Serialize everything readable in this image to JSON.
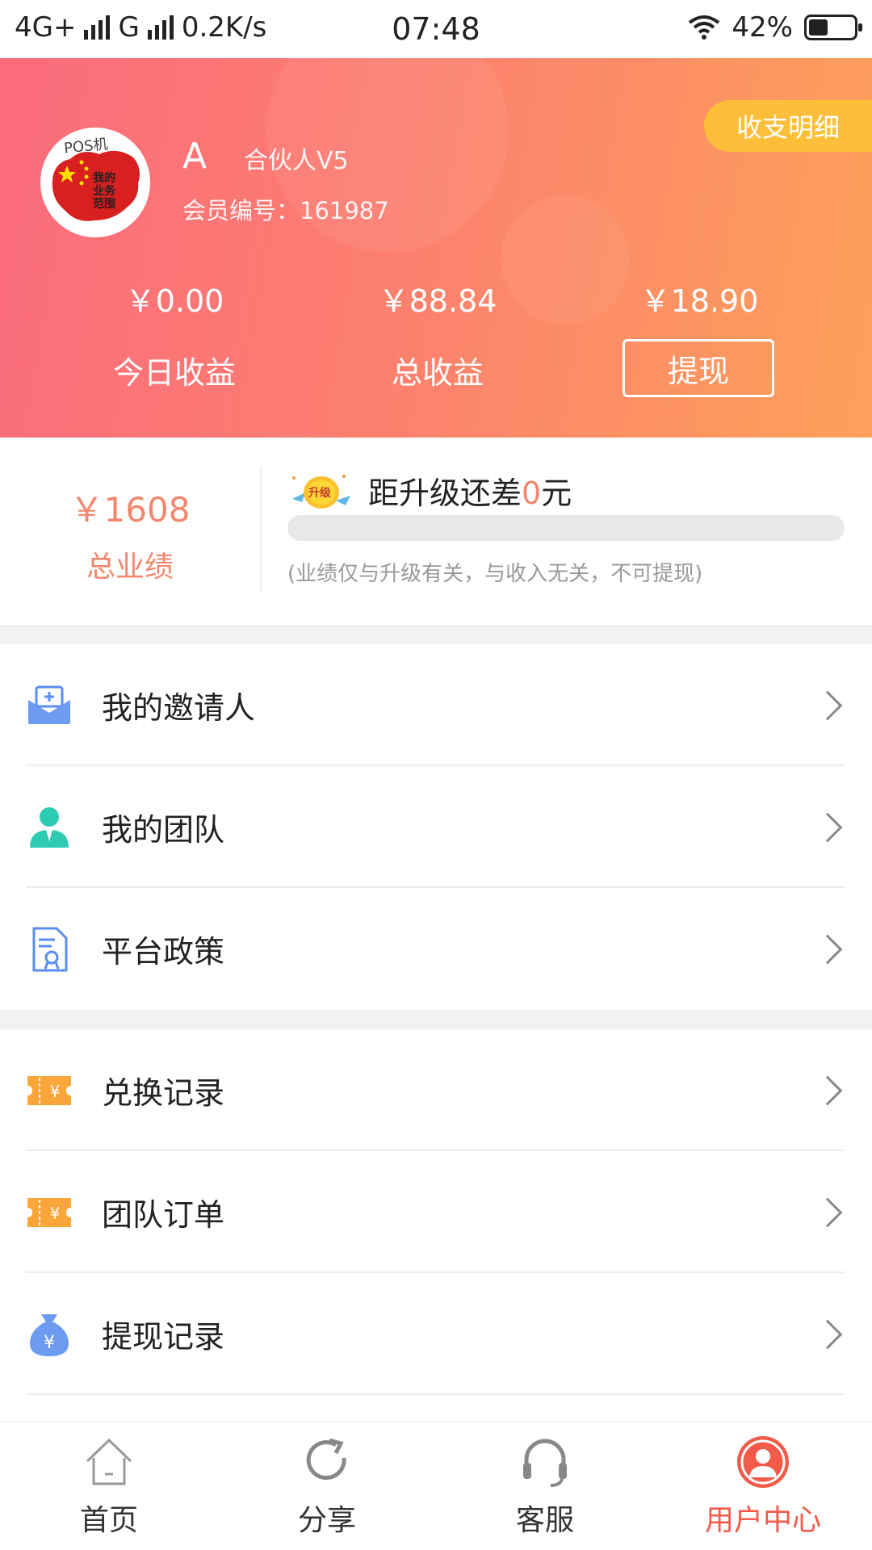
{
  "status_bar": {
    "network_1": "4G+",
    "network_2": "G",
    "speed": "0.2K/s",
    "time": "07:48",
    "battery": "42%",
    "battery_level": 0.42
  },
  "header": {
    "detail_button": "收支明细",
    "avatar_text_top": "POS机",
    "avatar_text_lines": [
      "我的",
      "业务",
      "范围"
    ],
    "user_name": "A",
    "user_level": "合伙人V5",
    "member_id": "会员编号：161987",
    "stats": [
      {
        "value": "￥0.00",
        "label": "今日收益"
      },
      {
        "value": "￥88.84",
        "label": "总收益"
      },
      {
        "value": "￥18.90",
        "label": ""
      }
    ],
    "withdraw_button": "提现"
  },
  "performance": {
    "total_value": "￥1608",
    "total_label": "总业绩",
    "upgrade_badge": "升级",
    "upgrade_prefix": "距升级还差",
    "upgrade_amount": "0",
    "upgrade_suffix": "元",
    "progress": 0,
    "note": "(业绩仅与升级有关，与收入无关，不可提现)"
  },
  "menu_group_1": [
    {
      "label": "我的邀请人",
      "icon": "envelope-icon"
    },
    {
      "label": "我的团队",
      "icon": "person-icon"
    },
    {
      "label": "平台政策",
      "icon": "document-badge-icon"
    }
  ],
  "menu_group_2": [
    {
      "label": "兑换记录",
      "icon": "ticket-yen-icon"
    },
    {
      "label": "团队订单",
      "icon": "ticket-yen-icon"
    },
    {
      "label": "提现记录",
      "icon": "money-bag-icon"
    }
  ],
  "tabbar": [
    {
      "label": "首页",
      "icon": "home-icon"
    },
    {
      "label": "分享",
      "icon": "share-refresh-icon"
    },
    {
      "label": "客服",
      "icon": "headset-icon"
    },
    {
      "label": "用户中心",
      "icon": "user-center-icon"
    }
  ],
  "colors": {
    "accent": "#f3876d",
    "tab_active": "#f25a4a",
    "header_gradient_start": "#fb6b7d",
    "header_gradient_end": "#fda15a",
    "detail_button": "#fdbf3a"
  }
}
